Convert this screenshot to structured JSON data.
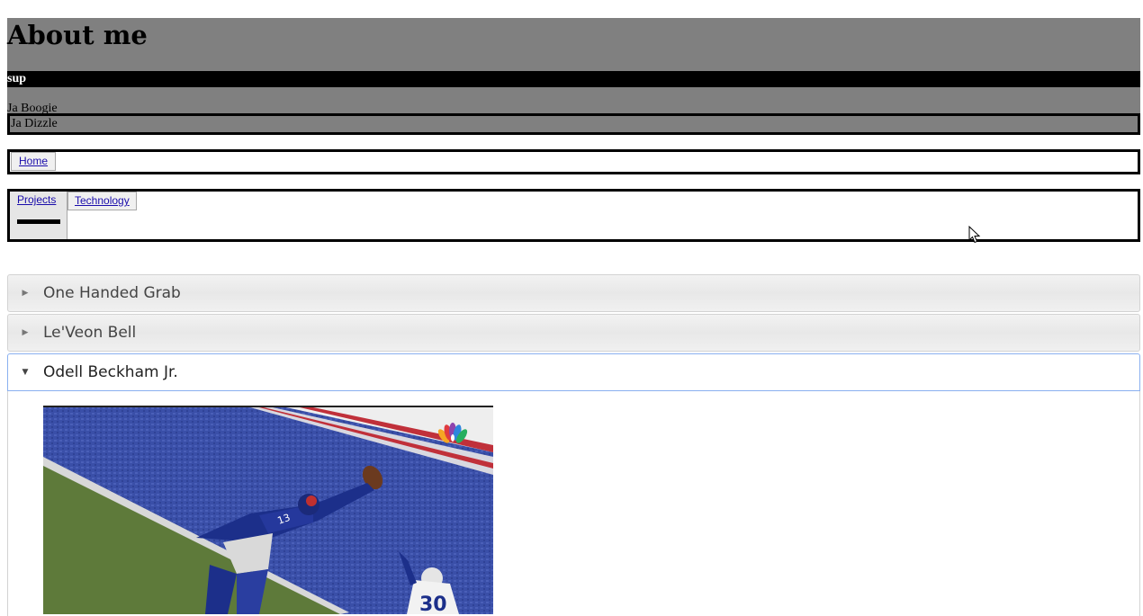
{
  "header": {
    "title": "About me",
    "sup_label": "sup",
    "name_line": "Ja Boogie",
    "boxed_name": "Ja Dizzle"
  },
  "nav_home": {
    "home_label": "Home"
  },
  "nav_projects": {
    "tabs": [
      "Projects",
      "Technology"
    ]
  },
  "accordion": {
    "items": [
      {
        "label": "One Handed Grab",
        "expanded": false
      },
      {
        "label": "Le'Veon Bell",
        "expanded": false
      },
      {
        "label": "Odell Beckham Jr.",
        "expanded": true
      }
    ]
  },
  "icons": {
    "collapsed_arrow": "triangle-right-icon",
    "expanded_arrow": "triangle-down-icon",
    "cursor": "mouse-pointer-icon",
    "broadcast_logo": "peacock-logo"
  },
  "colors": {
    "header_bg": "#808080",
    "sup_bar_bg": "#000000",
    "active_border": "#8ab0f0",
    "field_blue": "#3a4fa8",
    "field_green": "#5e7a3a"
  }
}
